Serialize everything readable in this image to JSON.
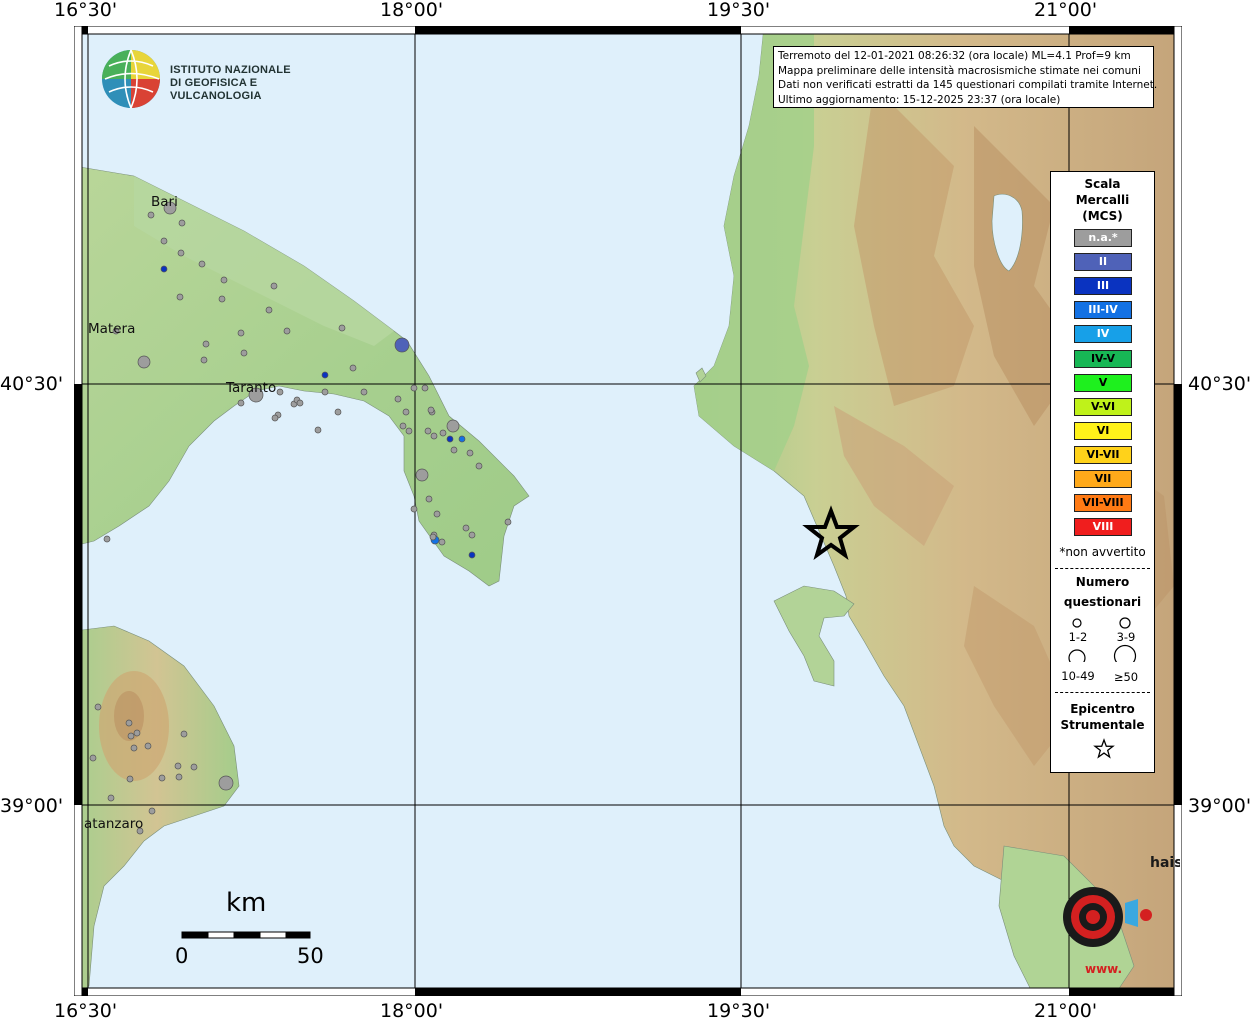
{
  "axes": {
    "top_labels": [
      "16°30'",
      "18°00'",
      "19°30'",
      "21°00'"
    ],
    "bottom_labels": [
      "16°30'",
      "18°00'",
      "19°30'",
      "21°00'"
    ],
    "left_labels": [
      "40°30'",
      "39°00'"
    ],
    "right_labels": [
      "40°30'",
      "39°00'"
    ]
  },
  "logo_ingv": {
    "line1": "ISTITUTO NAZIONALE",
    "line2": "DI GEOFISICA E VULCANOLOGIA"
  },
  "info": {
    "line1": "Terremoto del 12-01-2021 08:26:32 (ora locale) ML=4.1 Prof=9 km",
    "line2": "Mappa preliminare delle intensità macrosismiche stimate nei comuni",
    "line3": "Dati non verificati estratti da 145 questionari compilati tramite Internet.",
    "line4": "Ultimo aggiornamento: 15-12-2025 23:37 (ora locale)"
  },
  "cities": {
    "bari": "Bari",
    "matera": "Matera",
    "taranto": "Taranto",
    "catanzaro": "atanzaro"
  },
  "legend": {
    "title1": "Scala",
    "title2": "Mercalli",
    "title3": "(MCS)",
    "levels": [
      {
        "label": "n.a.*",
        "color": "#9d9d9d",
        "text_color": "#ffffff"
      },
      {
        "label": "II",
        "color": "#4f62b8",
        "text_color": "#ffffff"
      },
      {
        "label": "III",
        "color": "#0a33c0",
        "text_color": "#ffffff"
      },
      {
        "label": "III-IV",
        "color": "#1371e4",
        "text_color": "#ffffff"
      },
      {
        "label": "IV",
        "color": "#17a0e8",
        "text_color": "#ffffff"
      },
      {
        "label": "IV-V",
        "color": "#17b755",
        "text_color": "#000000"
      },
      {
        "label": "V",
        "color": "#1ef01e",
        "text_color": "#000000"
      },
      {
        "label": "V-VI",
        "color": "#bff21a",
        "text_color": "#000000"
      },
      {
        "label": "VI",
        "color": "#fff21a",
        "text_color": "#000000"
      },
      {
        "label": "VI-VII",
        "color": "#ffd21a",
        "text_color": "#000000"
      },
      {
        "label": "VII",
        "color": "#ffa91a",
        "text_color": "#000000"
      },
      {
        "label": "VII-VIII",
        "color": "#ff7a14",
        "text_color": "#000000"
      },
      {
        "label": "VIII",
        "color": "#f01e1e",
        "text_color": "#ffffff"
      }
    ],
    "note": "*non avvertito",
    "questionnaires_title1": "Numero",
    "questionnaires_title2": "questionari",
    "size_labels": [
      "1-2",
      "3-9",
      "10-49",
      "≥50"
    ],
    "epicenter_title1": "Epicentro",
    "epicenter_title2": "Strumentale"
  },
  "scalebar": {
    "unit": "km",
    "start": "0",
    "end": "50"
  },
  "logo_hst": {
    "text1": "haisentitoilterremoto.it",
    "text2": "www.",
    "accent": "#d42020"
  },
  "colors": {
    "sea": "#dff0fb",
    "land_low": "#a9cf8f",
    "land_mid": "#d8cc96",
    "land_high": "#c79d6f",
    "na_dot": "#9d9d9d",
    "grid": "#000000"
  }
}
